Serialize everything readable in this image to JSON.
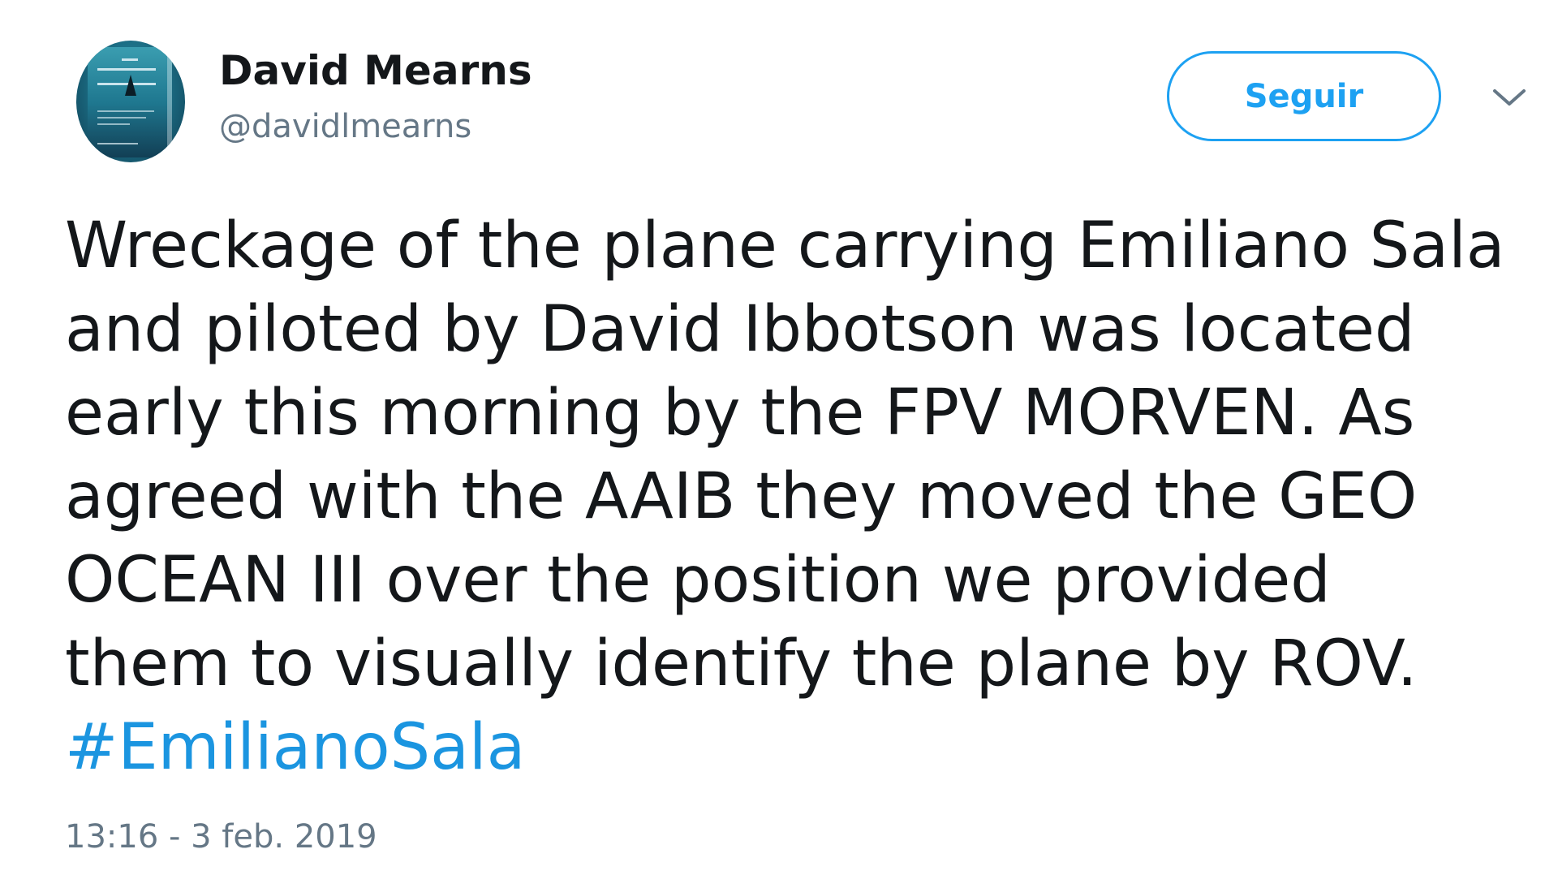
{
  "header": {
    "display_name": "David Mearns",
    "handle": "@davidlmearns",
    "follow_label": "Seguir",
    "avatar_icon": "book-cover-avatar",
    "menu_icon": "chevron-down-icon"
  },
  "tweet": {
    "lines": [
      "Wreckage of the plane carrying Emiliano Sala",
      "and piloted by David Ibbotson was located",
      "early this morning by the FPV MORVEN. As",
      "agreed with the AAIB they moved the GEO",
      "OCEAN III over the position we provided",
      "them to visually identify the plane by ROV."
    ],
    "hashtag": "#EmilianoSala",
    "timestamp": "13:16 - 3 feb. 2019"
  },
  "colors": {
    "accent": "#1da1f2",
    "hashtag": "#1b95e0",
    "text": "#14171a",
    "secondary_text": "#657786",
    "background": "#ffffff"
  }
}
